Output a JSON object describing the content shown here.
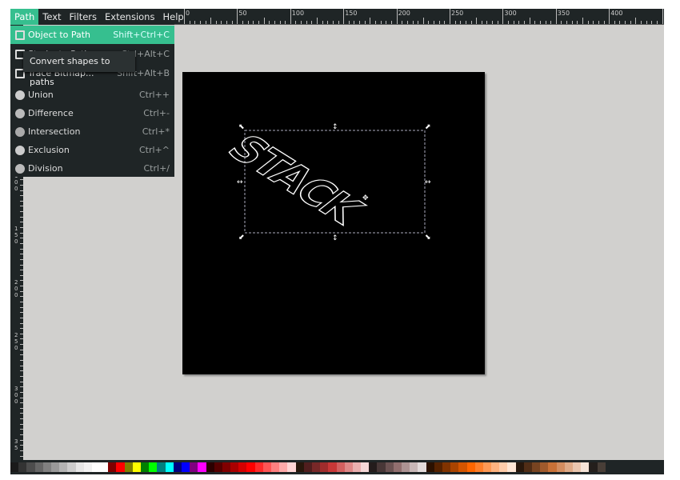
{
  "menubar": {
    "items": [
      "Path",
      "Text",
      "Filters",
      "Extensions",
      "Help"
    ],
    "active": "Path"
  },
  "ruler": {
    "h_labels": [
      "0",
      "50",
      "100",
      "150",
      "200",
      "250",
      "300",
      "350",
      "400"
    ],
    "v_labels": [
      "100",
      "150",
      "200",
      "250",
      "300",
      "35"
    ]
  },
  "path_menu": {
    "items": [
      {
        "label": "Object to Path",
        "shortcut": "Shift+Ctrl+C",
        "icon": "object-to-path-icon",
        "highlighted": true
      },
      {
        "label": "Stroke to Path",
        "shortcut": "Ctrl+Alt+C",
        "icon": "stroke-to-path-icon"
      },
      {
        "label": "Trace Bitmap...",
        "shortcut": "Shift+Alt+B",
        "icon": "trace-bitmap-icon"
      },
      {
        "label": "Union",
        "shortcut": "Ctrl++",
        "icon": "union-icon"
      },
      {
        "label": "Difference",
        "shortcut": "Ctrl+-",
        "icon": "difference-icon"
      },
      {
        "label": "Intersection",
        "shortcut": "Ctrl+*",
        "icon": "intersection-icon"
      },
      {
        "label": "Exclusion",
        "shortcut": "Ctrl+^",
        "icon": "exclusion-icon"
      },
      {
        "label": "Division",
        "shortcut": "Ctrl+/",
        "icon": "division-icon"
      }
    ]
  },
  "tooltip": "Convert shapes to paths",
  "canvas": {
    "text": "STACK",
    "page_color": "#000000"
  },
  "accent": "#36bf8f",
  "palette": [
    "#1a1a1a",
    "#333333",
    "#4d4d4d",
    "#666666",
    "#808080",
    "#999999",
    "#b3b3b3",
    "#cccccc",
    "#e6e6e6",
    "#f2f2f2",
    "#ffffff",
    "#ffffff",
    "#800000",
    "#ff0000",
    "#808000",
    "#ffff00",
    "#008000",
    "#00ff00",
    "#008080",
    "#00ffff",
    "#000080",
    "#0000ff",
    "#800080",
    "#ff00ff",
    "#2b0000",
    "#550000",
    "#800000",
    "#aa0000",
    "#d40000",
    "#ff0000",
    "#ff2a2a",
    "#ff5555",
    "#ff8080",
    "#ffaaaa",
    "#ffd5d5",
    "#28170b",
    "#501e1e",
    "#782828",
    "#a02c2c",
    "#c83737",
    "#d35f5f",
    "#de8787",
    "#e9afaf",
    "#f4d7d7",
    "#241c1c",
    "#483737",
    "#6c5353",
    "#916f6f",
    "#ac9393",
    "#c8b7b7",
    "#e3dbdb",
    "#2b1100",
    "#552200",
    "#803300",
    "#aa4400",
    "#d45500",
    "#ff6600",
    "#ff7f2a",
    "#ff9955",
    "#ffb380",
    "#ffccaa",
    "#ffe6d5",
    "#28170b",
    "#502d16",
    "#784421",
    "#a05a2c",
    "#c87137",
    "#d38d5f",
    "#deaa87",
    "#e9c6af",
    "#f4e3d7",
    "#241f1c",
    "#483e37"
  ]
}
